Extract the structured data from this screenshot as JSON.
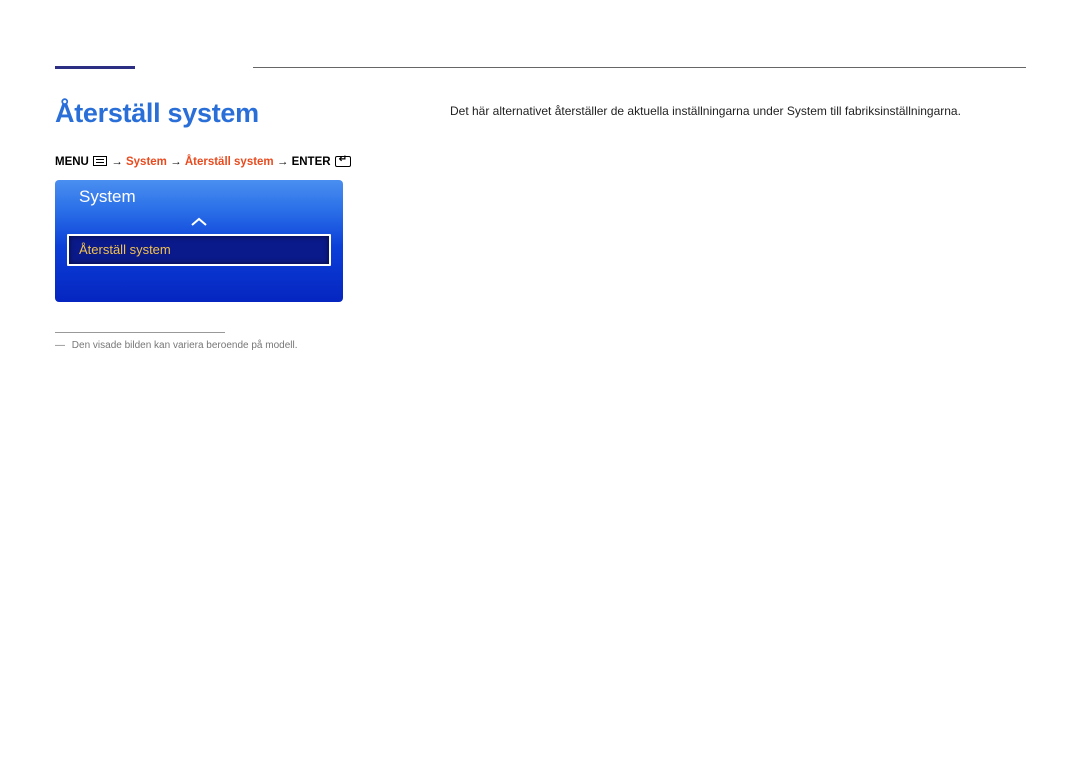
{
  "page": {
    "title": "Återställ system"
  },
  "breadcrumb": {
    "menu_label": "MENU",
    "arrow": "→",
    "system": "System",
    "item": "Återställ system",
    "enter_label": "ENTER"
  },
  "osd": {
    "header": "System",
    "selected_item": "Återställ system"
  },
  "footnote": {
    "dash": "―",
    "text": "Den visade bilden kan variera beroende på modell."
  },
  "description": {
    "text": "Det här alternativet återställer de aktuella inställningarna under System till fabriksinställningarna."
  }
}
